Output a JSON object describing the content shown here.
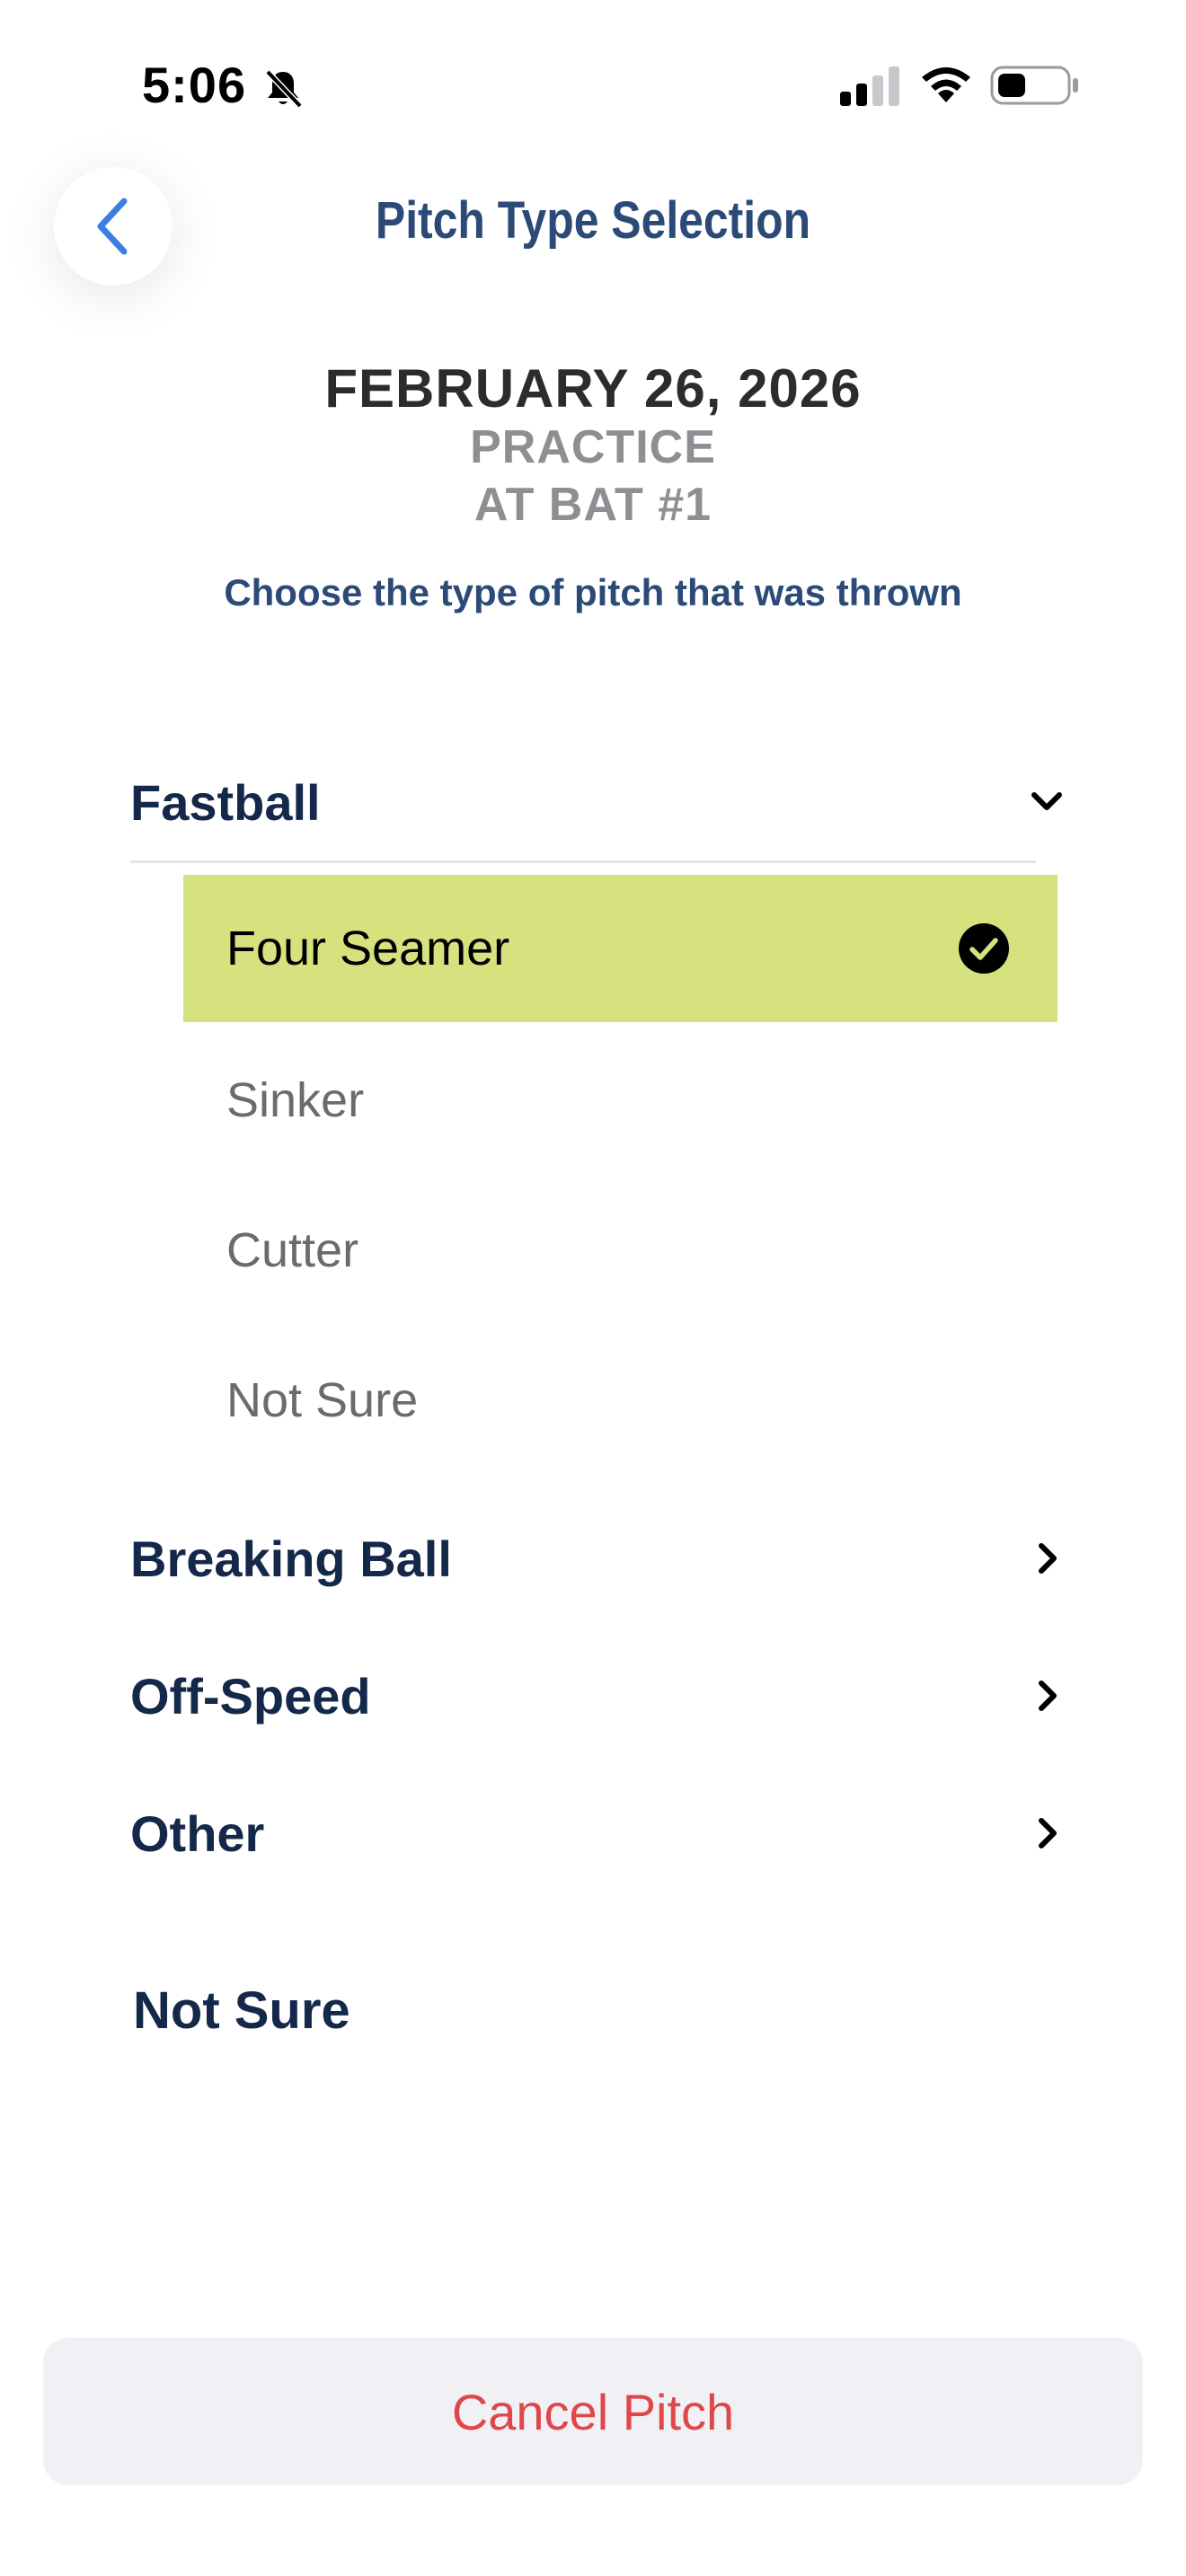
{
  "status_bar": {
    "time": "5:06",
    "icons": [
      "bell-slash-icon",
      "cellular-signal-icon",
      "wifi-icon",
      "battery-icon"
    ]
  },
  "header": {
    "title": "Pitch Type Selection",
    "back_icon": "chevron-left-icon"
  },
  "session": {
    "date": "FEBRUARY 26, 2026",
    "type": "PRACTICE",
    "at_bat": "AT BAT #1",
    "instruction": "Choose the type of pitch that was thrown"
  },
  "categories": [
    {
      "label": "Fastball",
      "expanded": true,
      "options": [
        {
          "label": "Four Seamer",
          "selected": true
        },
        {
          "label": "Sinker",
          "selected": false
        },
        {
          "label": "Cutter",
          "selected": false
        },
        {
          "label": "Not Sure",
          "selected": false
        }
      ]
    },
    {
      "label": "Breaking Ball",
      "expanded": false
    },
    {
      "label": "Off-Speed",
      "expanded": false
    },
    {
      "label": "Other",
      "expanded": false
    }
  ],
  "not_sure_label": "Not Sure",
  "cancel_label": "Cancel Pitch",
  "colors": {
    "selected_bg": "#d6e27d",
    "title_blue": "#2b4a78",
    "category_navy": "#14284a",
    "cancel_red": "#e0474b",
    "back_blue": "#3b7fe0"
  }
}
